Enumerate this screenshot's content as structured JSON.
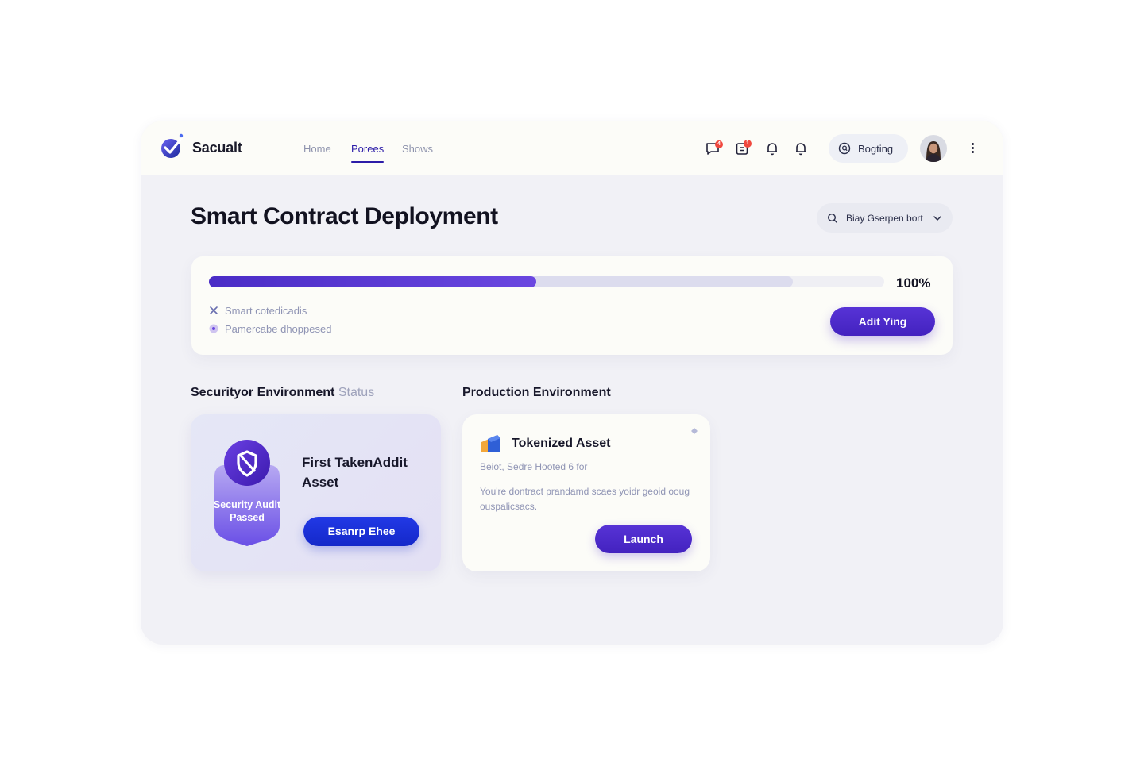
{
  "app": {
    "brand": "Sacualt",
    "nav": [
      {
        "label": "Home",
        "active": false
      },
      {
        "label": "Porees",
        "active": true
      },
      {
        "label": "Shows",
        "active": false
      }
    ],
    "notifications": [
      {
        "icon": "chat-icon",
        "badge": "4"
      },
      {
        "icon": "clipboard-icon",
        "badge": "1"
      },
      {
        "icon": "bell-icon"
      },
      {
        "icon": "bell-icon"
      }
    ],
    "status_button": {
      "label": "Bogting",
      "icon": "help-circle-icon"
    },
    "avatar": "user-avatar",
    "menu_icon": "more-vertical-icon"
  },
  "page": {
    "title": "Smart Contract Deployment",
    "env_select": {
      "label": "Biay Gserpen bort",
      "icon": "search-icon",
      "chevron": "chevron-down-icon"
    }
  },
  "progress": {
    "percent_label": "100%",
    "fill_fraction": 0.485,
    "buffer_fraction": 0.865,
    "steps": [
      {
        "label": "Smart cotedicadis",
        "icon": "close-icon"
      },
      {
        "label": "Pamercabe dhoppesed",
        "icon": "record-icon"
      }
    ],
    "action_label": "Adit Ying"
  },
  "sections": {
    "security": {
      "heading": "Securityor Environment",
      "heading_muted": "Status",
      "badge_icon": "shield-icon",
      "badge_text": "Security Audit Passed",
      "title": "First TakenAddit Asset",
      "button_label": "Esanrp Ehee"
    },
    "production": {
      "heading": "Production Environment",
      "icon": "cube-icon",
      "title": "Tokenized Asset",
      "meta": "Beiot, Sedre Hooted 6 for",
      "description": "You're dontract prandamd scaes yoidr geoid ooug ouspalicsacs.",
      "button_label": "Launch"
    }
  },
  "colors": {
    "accent": "#4a2cc6",
    "blue_button": "#1a30d6",
    "badge_red": "#f0483e"
  }
}
